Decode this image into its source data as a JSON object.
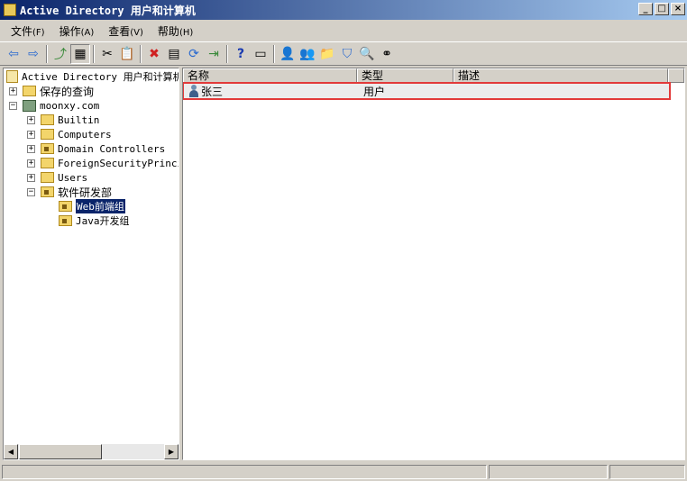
{
  "window": {
    "title": "Active Directory 用户和计算机",
    "minimize": "_",
    "maximize": "□",
    "close": "×"
  },
  "menu": [
    {
      "label": "文件",
      "acc": "(F)"
    },
    {
      "label": "操作",
      "acc": "(A)"
    },
    {
      "label": "查看",
      "acc": "(V)"
    },
    {
      "label": "帮助",
      "acc": "(H)"
    }
  ],
  "toolbar": {
    "back": "⇦",
    "forward": "⇨",
    "up": "⤴",
    "show_tree": "▦",
    "cut": "✂",
    "paste": "📋",
    "delete": "✖",
    "properties": "▤",
    "refresh": "⟳",
    "export": "⇥",
    "help": "?",
    "console": "▭",
    "new_user": "👤",
    "new_group": "👥",
    "new_ou": "📁",
    "filter": "⛉",
    "find": "🔍",
    "add_to_group": "⚭"
  },
  "tree": {
    "root": "Active Directory 用户和计算机",
    "saved_queries": "保存的查询",
    "domain": "moonxy.com",
    "builtin": "Builtin",
    "computers": "Computers",
    "domain_controllers": "Domain Controllers",
    "foreign": "ForeignSecurityPrincip",
    "users": "Users",
    "software_dept": "软件研发部",
    "web_group": "Web前端组",
    "java_group": "Java开发组",
    "plus": "+",
    "minus": "−"
  },
  "list": {
    "columns": [
      "名称",
      "类型",
      "描述"
    ],
    "rows": [
      {
        "name": "张三",
        "type": "用户",
        "description": ""
      }
    ]
  },
  "scroll": {
    "left": "◀",
    "right": "▶"
  }
}
